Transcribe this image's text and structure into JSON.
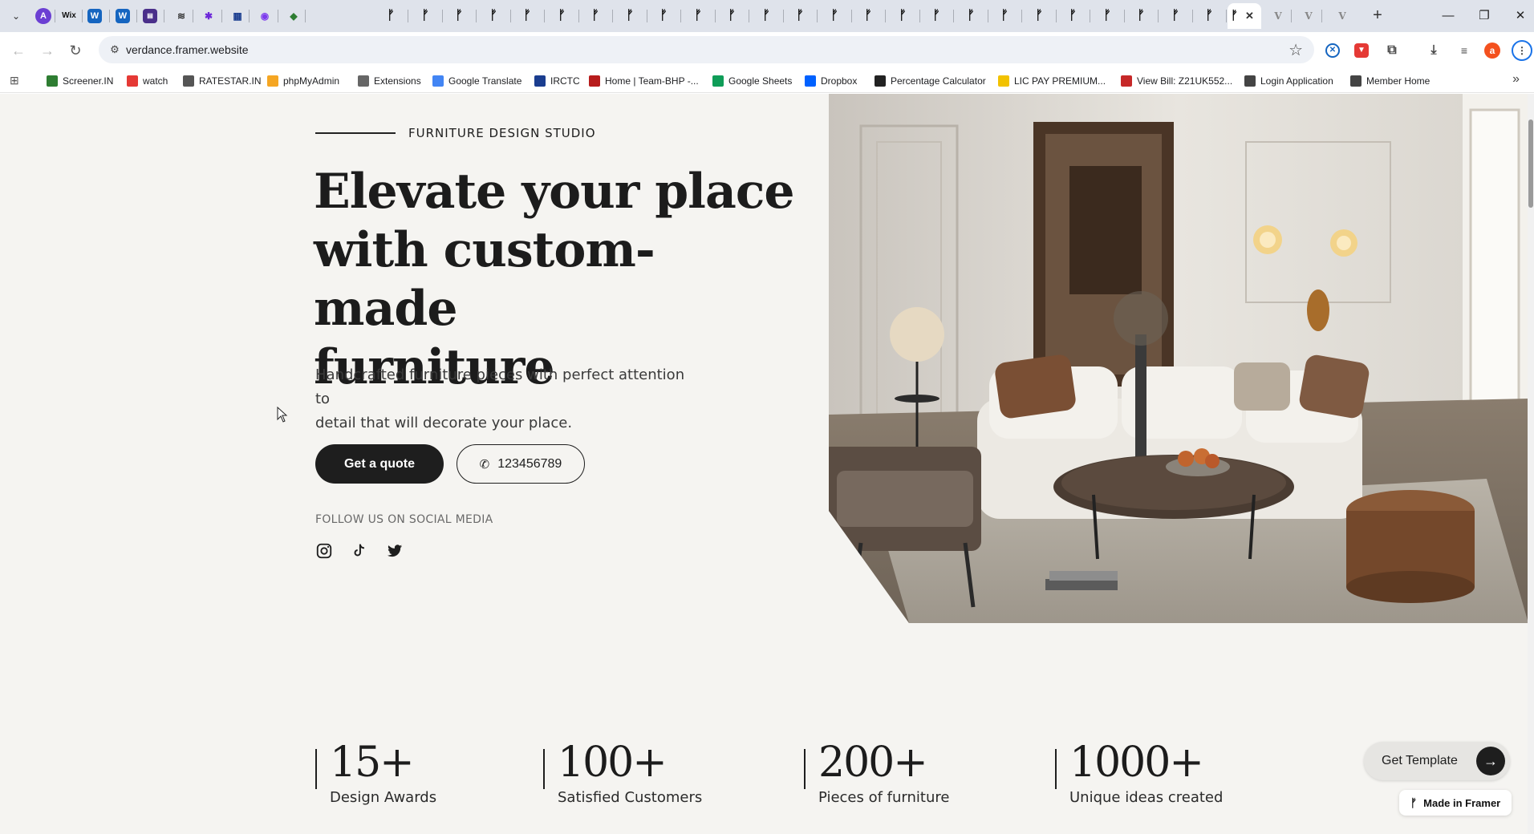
{
  "browser": {
    "tabs": [
      {
        "icon": "wix-icon",
        "glyph": "Wix"
      },
      {
        "icon": "framer-icon",
        "glyph": "F"
      }
    ],
    "url": "verdance.framer.website",
    "bookmarks": [
      {
        "label": "Screener.IN",
        "color": "#2e7d32",
        "icon": "chart-icon"
      },
      {
        "label": "watch",
        "color": "#e53935",
        "icon": "youtube-icon"
      },
      {
        "label": "RATESTAR.IN",
        "color": "#555555",
        "icon": "star-icon"
      },
      {
        "label": "phpMyAdmin",
        "color": "#f5a623",
        "icon": "phpmyadmin-icon"
      },
      {
        "label": "Extensions",
        "color": "#666666",
        "icon": "puzzle-icon"
      },
      {
        "label": "Google Translate",
        "color": "#4285f4",
        "icon": "translate-icon"
      },
      {
        "label": "IRCTC",
        "color": "#1a3d8f",
        "icon": "irctc-icon"
      },
      {
        "label": "Home | Team-BHP -...",
        "color": "#b71c1c",
        "icon": "teambhp-icon"
      },
      {
        "label": "Google Sheets",
        "color": "#0f9d58",
        "icon": "sheets-icon"
      },
      {
        "label": "Dropbox",
        "color": "#0061ff",
        "icon": "dropbox-icon"
      },
      {
        "label": "Percentage Calculator",
        "color": "#222222",
        "icon": "percent-icon"
      },
      {
        "label": "LIC PAY PREMIUM...",
        "color": "#f2c200",
        "icon": "lic-icon"
      },
      {
        "label": "View Bill: Z21UK552...",
        "color": "#c62828",
        "icon": "bill-icon"
      },
      {
        "label": "Login Application",
        "color": "#444444",
        "icon": "login-icon"
      },
      {
        "label": "Member Home",
        "color": "#444444",
        "icon": "globe-icon"
      }
    ]
  },
  "hero": {
    "eyebrow": "FURNITURE DESIGN STUDIO",
    "headline_lines": [
      "Elevate your place",
      "with custom-made",
      "furniture"
    ],
    "subhead_line1": "Handcrafted furniture pieces with perfect attention to",
    "subhead_line2": "detail that will decorate your place.",
    "cta_quote": "Get a quote",
    "cta_phone": "123456789",
    "social_label": "FOLLOW US ON SOCIAL MEDIA",
    "social_icons": [
      "instagram-icon",
      "tiktok-icon",
      "twitter-icon"
    ]
  },
  "stats": [
    {
      "value": "15+",
      "label": "Design Awards"
    },
    {
      "value": "100+",
      "label": "Satisfied Customers"
    },
    {
      "value": "200+",
      "label": "Pieces of furniture"
    },
    {
      "value": "1000+",
      "label": "Unique ideas created"
    }
  ],
  "floating": {
    "get_template": "Get Template",
    "made_in_framer": "Made in Framer"
  },
  "colors": {
    "page_bg": "#f5f4f1",
    "ink": "#1e1e1e",
    "tabstrip": "#dfe3eb"
  }
}
